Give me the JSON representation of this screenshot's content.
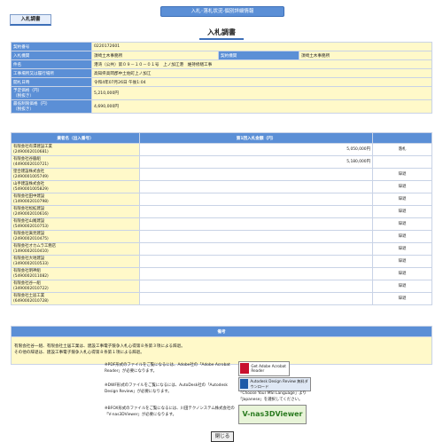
{
  "top_banner": "入札･落札状況-個別詳細情報",
  "tab_label": "入札調書",
  "page_title": "入札調書",
  "info": {
    "contract_no_label": "契約番号",
    "contract_no": "0220172601",
    "bid_agency_label": "入札機関",
    "bid_agency": "須崎土木事務所",
    "contract_agency_label": "契約機関",
    "contract_agency": "須崎土木事務所",
    "project_label": "件名",
    "project": "港湾（公共）第０９－１０－０１号　上ノ加江港　維持修繕工事",
    "location_label": "工事場所又は履行場所",
    "location": "高知県高岡郡中土佐町上ノ加江",
    "open_date_label": "開札日時",
    "open_date": "令和4年07月26日 午後1:04",
    "planned_price_label": "予定価格（円）\n（税抜き）",
    "planned_price": "5,210,000円",
    "min_price_label": "最低制限価格（円）\n（税抜き）",
    "min_price": "4,690,000円"
  },
  "bids_header": {
    "name": "業者名（出入番号）",
    "amount": "第1回入札金額（円）",
    "result": ""
  },
  "bids": [
    {
      "name": "有限会社有澤建設工業",
      "code": "(2490002010681)",
      "amount": "5,050,000円",
      "result": "落札"
    },
    {
      "name": "有限会社谷脇組",
      "code": "(4490002010721)",
      "amount": "5,180,000円",
      "result": ""
    },
    {
      "name": "窪合建設株式会社",
      "code": "(2490001005749)",
      "amount": "",
      "result": "辞退"
    },
    {
      "name": "山手建設株式会社",
      "code": "(5490001005829)",
      "amount": "",
      "result": "辞退"
    },
    {
      "name": "有限会社田中建設",
      "code": "(1490002010798)",
      "amount": "",
      "result": "辞退"
    },
    {
      "name": "有限会社松拡建設",
      "code": "(2490002010616)",
      "amount": "",
      "result": "辞退"
    },
    {
      "name": "有限会社山尾建設",
      "code": "(5490002010753)",
      "amount": "",
      "result": "辞退"
    },
    {
      "name": "有限会社眞見建設",
      "code": "(2490002010475)",
      "amount": "",
      "result": "辞退"
    },
    {
      "name": "有限会社オカムラ工務店",
      "code": "(1490002010410)",
      "amount": "",
      "result": "辞退"
    },
    {
      "name": "有限会社大地建設",
      "code": "(3490002010533)",
      "amount": "",
      "result": "辞退"
    },
    {
      "name": "有限会社明神組",
      "code": "(5490002011082)",
      "amount": "",
      "result": "辞退"
    },
    {
      "name": "有限会社谷一組",
      "code": "(3490002010722)",
      "amount": "",
      "result": "辞退"
    },
    {
      "name": "有限会社土居工業",
      "code": "(6490002010728)",
      "amount": "",
      "result": "辞退"
    }
  ],
  "notes_header": "備考",
  "notes_text": "有限会社谷一組、有限会社土居工業は、建設工事電子競争入札心得第８条第３項による辞退。\nその他の辞退は、建設工事電子競争入札心得第８条第１項による辞退。",
  "plugins": {
    "pdf_text": "※PDF形式のファイルをご覧になるには、Adobe社の「Adobe Acrobat Reader」が必要になります。",
    "pdf_badge": "Get Adobe Acrobat Reader",
    "dwf_text": "※DWF形式のファイルをご覧になるには、AutoDesk社の「Autodesk Design Review」が必要になります。",
    "dwf_badge": "Autodesk Design Review 無料ダウンロード",
    "dwf_note": "「Choose Your MSI Language」より「Japanese」を選択してください。",
    "sfc_text": "※BFOX形式のファイルをご覧になるには、川田テクノシステム株式会社の「V-nas3DViewer」が必要になります。",
    "sfc_badge": "V-nas3DViewer"
  },
  "close_label": "閉じる"
}
